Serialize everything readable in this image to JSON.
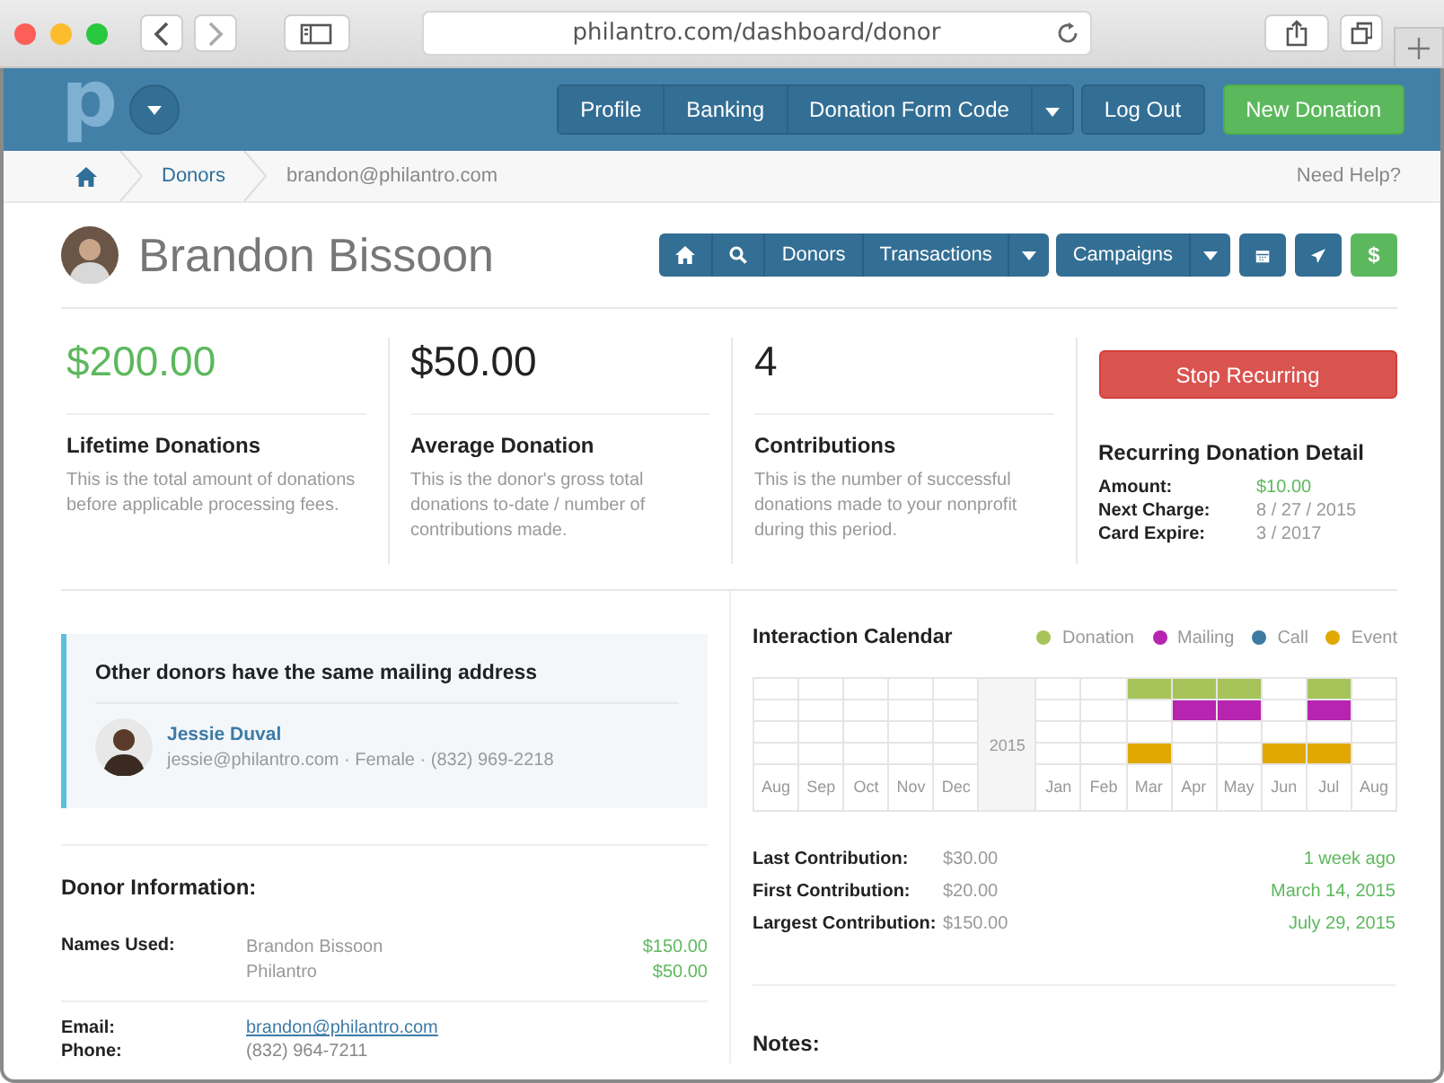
{
  "browser": {
    "url": "philantro.com/dashboard/donor"
  },
  "header": {
    "logo": "p",
    "nav_group": [
      "Profile",
      "Banking",
      "Donation Form Code"
    ],
    "logout": "Log Out",
    "primary": "New Donation"
  },
  "breadcrumb": {
    "items": [
      "Donors",
      "brandon@philantro.com"
    ],
    "help": "Need Help?"
  },
  "donor": {
    "name": "Brandon Bissoon"
  },
  "toolbar": {
    "nav": [
      "Donors",
      "Transactions"
    ],
    "campaigns": "Campaigns",
    "money": "$"
  },
  "stats": [
    {
      "value": "$200.00",
      "highlight": true,
      "title": "Lifetime Donations",
      "description": "This is the total amount of donations before applicable processing fees."
    },
    {
      "value": "$50.00",
      "highlight": false,
      "title": "Average Donation",
      "description": "This is the donor's gross total donations to-date / number of contributions made."
    },
    {
      "value": "4",
      "highlight": false,
      "title": "Contributions",
      "description": "This is the number of successful donations made to your nonprofit during this period."
    }
  ],
  "recurring": {
    "button": "Stop Recurring",
    "title": "Recurring Donation Detail",
    "details": [
      {
        "label": "Amount:",
        "value": "$10.00",
        "highlight": true
      },
      {
        "label": "Next Charge:",
        "value": "8 / 27 / 2015",
        "highlight": false
      },
      {
        "label": "Card Expire:",
        "value": "3 / 2017",
        "highlight": false
      }
    ]
  },
  "notice": {
    "title": "Other donors have the same mailing address",
    "person": {
      "name": "Jessie Duval",
      "info": "jessie@philantro.com · Female · (832) 969-2218"
    }
  },
  "donor_info": {
    "title": "Donor Information:",
    "names_label": "Names Used:",
    "names": [
      {
        "name": "Brandon Bissoon",
        "amount": "$150.00"
      },
      {
        "name": "Philantro",
        "amount": "$50.00"
      }
    ],
    "fields": [
      {
        "label": "Email:",
        "value": "brandon@philantro.com",
        "kind": "link"
      },
      {
        "label": "Phone:",
        "value": "(832) 964-7211",
        "kind": "text"
      }
    ]
  },
  "calendar": {
    "title": "Interaction Calendar",
    "legend": [
      {
        "label": "Donation",
        "color": "#a6c45a"
      },
      {
        "label": "Mailing",
        "color": "#b624b0"
      },
      {
        "label": "Call",
        "color": "#3d7ba3"
      },
      {
        "label": "Event",
        "color": "#e0a800"
      }
    ],
    "columns": [
      {
        "kind": "month",
        "label": "Aug",
        "active": [
          false,
          false,
          false,
          false
        ]
      },
      {
        "kind": "month",
        "label": "Sep",
        "active": [
          false,
          false,
          false,
          false
        ]
      },
      {
        "kind": "month",
        "label": "Oct",
        "active": [
          false,
          false,
          false,
          false
        ]
      },
      {
        "kind": "month",
        "label": "Nov",
        "active": [
          false,
          false,
          false,
          false
        ]
      },
      {
        "kind": "month",
        "label": "Dec",
        "active": [
          false,
          false,
          false,
          false
        ]
      },
      {
        "kind": "year",
        "label": "2015"
      },
      {
        "kind": "month",
        "label": "Jan",
        "active": [
          false,
          false,
          false,
          false
        ]
      },
      {
        "kind": "month",
        "label": "Feb",
        "active": [
          false,
          false,
          false,
          false
        ]
      },
      {
        "kind": "month",
        "label": "Mar",
        "active": [
          true,
          false,
          false,
          true
        ]
      },
      {
        "kind": "month",
        "label": "Apr",
        "active": [
          true,
          true,
          false,
          false
        ]
      },
      {
        "kind": "month",
        "label": "May",
        "active": [
          true,
          true,
          false,
          false
        ]
      },
      {
        "kind": "month",
        "label": "Jun",
        "active": [
          false,
          false,
          false,
          true
        ]
      },
      {
        "kind": "month",
        "label": "Jul",
        "active": [
          true,
          true,
          false,
          true
        ]
      },
      {
        "kind": "month",
        "label": "Aug",
        "active": [
          false,
          false,
          false,
          false
        ]
      }
    ]
  },
  "contributions": [
    {
      "label": "Last Contribution:",
      "amount": "$30.00",
      "date": "1 week ago"
    },
    {
      "label": "First Contribution:",
      "amount": "$20.00",
      "date": "March 14, 2015"
    },
    {
      "label": "Largest Contribution:",
      "amount": "$150.00",
      "date": "July 29, 2015"
    }
  ],
  "notes": {
    "title": "Notes:"
  }
}
